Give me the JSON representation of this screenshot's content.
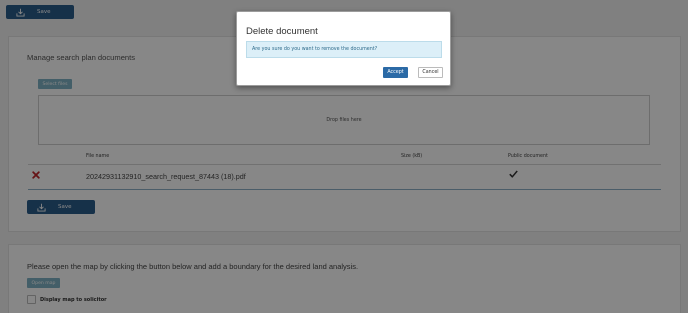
{
  "toolbar": {
    "save_label": "Save"
  },
  "documents_panel": {
    "title": "Manage search plan documents",
    "select_files_label": "Select files",
    "dropzone_text": "Drop files here",
    "columns": {
      "file_name": "File name",
      "size": "Size (kB)",
      "public": "Public document"
    },
    "rows": [
      {
        "file_name": "20242931132910_search_request_87443 (18).pdf",
        "size": "",
        "public": true
      }
    ],
    "save_label": "Save"
  },
  "map_panel": {
    "instructions": "Please open the map by clicking the button below and add a boundary for the desired land analysis.",
    "open_map_label": "Open map",
    "display_map_label": "Display map to solicitor"
  },
  "dialog": {
    "title": "Delete document",
    "message": "Are you sure do you want to remove the document?",
    "accept_label": "Accept",
    "cancel_label": "Cancel"
  },
  "icons": {
    "save": "download-tray-icon",
    "remove": "red-x-icon",
    "public": "checkmark-icon"
  },
  "colors": {
    "primary_button": "#2b5d8b",
    "secondary_button": "#7fb2c4",
    "remove_icon": "#c0262b",
    "overlay": "rgba(0,0,0,0.47)"
  }
}
